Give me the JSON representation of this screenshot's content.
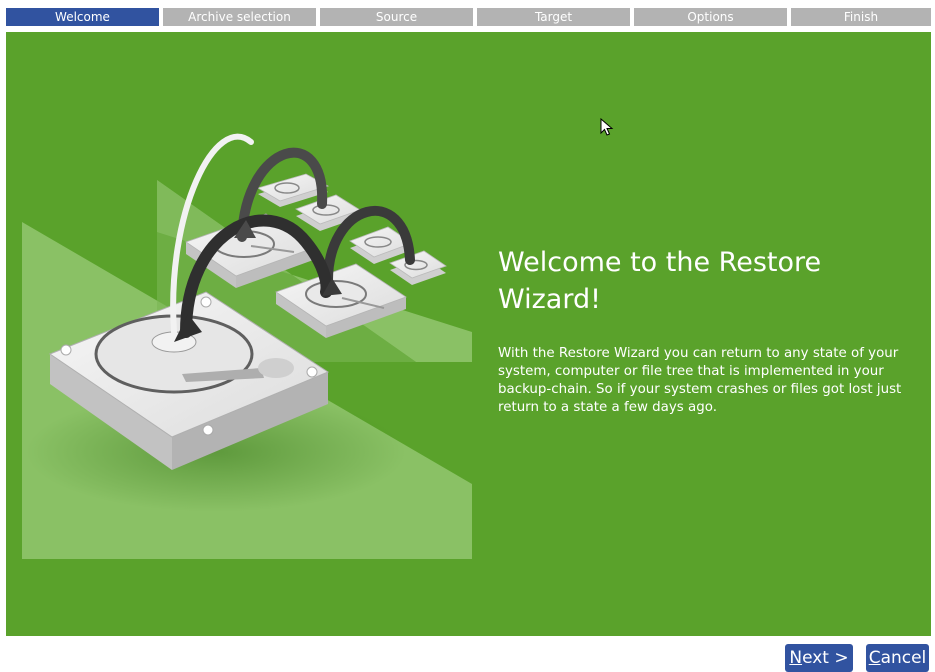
{
  "steps": [
    {
      "label": "Welcome",
      "active": true
    },
    {
      "label": "Archive selection",
      "active": false
    },
    {
      "label": "Source",
      "active": false
    },
    {
      "label": "Target",
      "active": false
    },
    {
      "label": "Options",
      "active": false
    },
    {
      "label": "Finish",
      "active": false
    }
  ],
  "main": {
    "title": "Welcome to the Restore Wizard!",
    "description": "With the Restore Wizard you can return to any state of your system, computer or file tree that is implemented in your backup-chain. So if your system crashes or files got lost just return to a state a few days ago."
  },
  "buttons": {
    "next_mnemonic": "N",
    "next_rest": "ext >",
    "cancel_mnemonic": "C",
    "cancel_rest": "ancel"
  },
  "colors": {
    "panel_bg": "#5aa22b",
    "active_step": "#3153a0",
    "inactive_step": "#b3b3b3",
    "button_bg": "#3153a0"
  },
  "icons": [
    "hard-drive-icon",
    "arrow-icon",
    "mouse-cursor-icon"
  ]
}
